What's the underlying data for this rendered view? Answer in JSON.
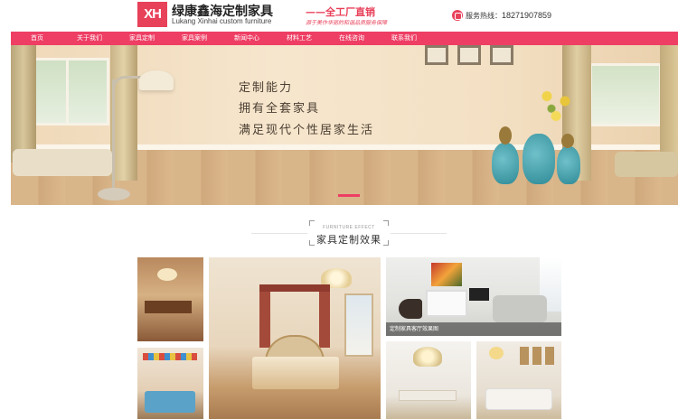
{
  "header": {
    "logo_mark": "XH",
    "company_cn": "绿康鑫海定制家具",
    "company_en": "Lukang Xinhai custom furniture",
    "slogan": "——全工厂直销",
    "slogan_sub": "源于美作华丽的和谐品质服务保障",
    "phone_label": "服务热线：",
    "phone_number": "18271907859"
  },
  "nav": {
    "items": [
      {
        "label": "首页"
      },
      {
        "label": "关于我们"
      },
      {
        "label": "家具定制"
      },
      {
        "label": "家具案例"
      },
      {
        "label": "新闻中心"
      },
      {
        "label": "材料工艺"
      },
      {
        "label": "在线咨询"
      },
      {
        "label": "联系我们"
      }
    ]
  },
  "banner": {
    "lines": [
      "定制能力",
      "拥有全套家具",
      "满足现代个性居家生活"
    ],
    "slide_index": 1
  },
  "section": {
    "title_en": "FURNITURE EFFECT",
    "title_cn": "家具定制效果"
  },
  "gallery": {
    "featured_caption": "定制家具客厅效果图"
  },
  "colors": {
    "brand": "#ee3e64",
    "logo": "#e8415a"
  }
}
